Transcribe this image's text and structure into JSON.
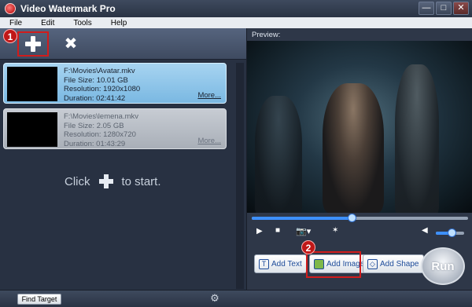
{
  "window": {
    "title": "Video Watermark Pro",
    "controls": {
      "minimize": "—",
      "maximize": "□",
      "close": "✕"
    }
  },
  "menu": {
    "items": [
      "File",
      "Edit",
      "Tools",
      "Help"
    ]
  },
  "toolbar": {
    "add_icon": "plus-icon",
    "delete_icon": "x-icon"
  },
  "annotations": {
    "badge1": "1",
    "badge2": "2"
  },
  "files": [
    {
      "path": "F:\\Movies\\Avatar.mkv",
      "size": "File Size: 10.01 GB",
      "resolution": "Resolution: 1920x1080",
      "duration": "Duration: 02:41:42",
      "more": "More...",
      "selected": true
    },
    {
      "path": "F:\\Movies\\lemena.mkv",
      "size": "File Size: 2.05 GB",
      "resolution": "Resolution: 1280x720",
      "duration": "Duration: 01:43:29",
      "more": "More...",
      "selected": false
    }
  ],
  "hint": {
    "before": "Click",
    "after": "to start."
  },
  "preview": {
    "label": "Preview:",
    "seek_progress": 0.46,
    "volume_level": 0.55
  },
  "player_controls": {
    "play_icon": "play-icon",
    "stop_icon": "stop-icon",
    "snapshot_icon": "camera-icon",
    "effect_icon": "wand-icon",
    "volume_icon": "speaker-icon"
  },
  "actions": {
    "add_text": "Add Text",
    "add_image": "Add Image",
    "add_shape": "Add Shape",
    "run": "Run"
  },
  "status": {
    "find_target": "Find Target",
    "settings_icon": "gear-icon"
  },
  "colors": {
    "accent": "#3d90ff",
    "highlight": "#d11c1c",
    "selected_item": "#8fc6ea"
  }
}
